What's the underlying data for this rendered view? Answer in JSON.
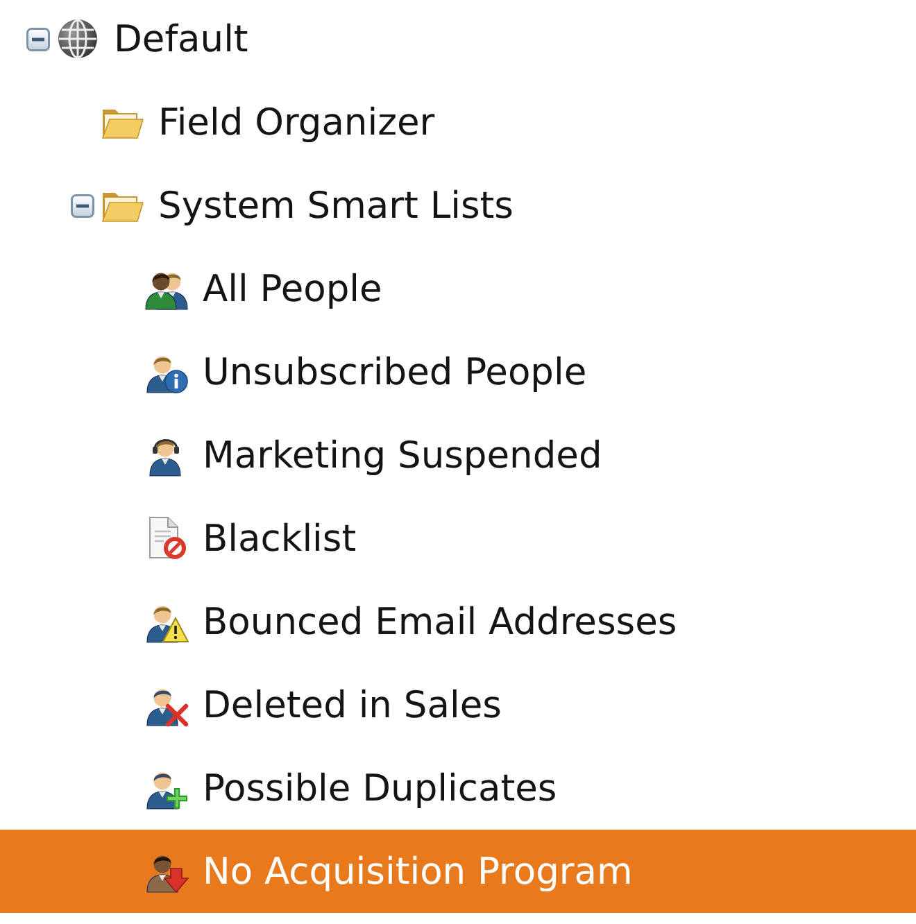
{
  "tree": [
    {
      "label": "Default",
      "kind": "globe",
      "expanded": true,
      "selected": false,
      "children": [
        {
          "label": "Field Organizer",
          "kind": "folder",
          "selected": false
        },
        {
          "label": "System Smart Lists",
          "kind": "folder",
          "expanded": true,
          "selected": false,
          "children": [
            {
              "label": "All People",
              "kind": "people",
              "selected": false
            },
            {
              "label": "Unsubscribed People",
              "kind": "person-info",
              "selected": false
            },
            {
              "label": "Marketing Suspended",
              "kind": "person-headset",
              "selected": false
            },
            {
              "label": "Blacklist",
              "kind": "document-blocked",
              "selected": false
            },
            {
              "label": "Bounced Email Addresses",
              "kind": "person-warning",
              "selected": false
            },
            {
              "label": "Deleted in Sales",
              "kind": "person-cross",
              "selected": false
            },
            {
              "label": "Possible Duplicates",
              "kind": "person-plus",
              "selected": false
            },
            {
              "label": "No Acquisition Program",
              "kind": "person-down-arrow",
              "selected": true
            }
          ]
        }
      ]
    }
  ]
}
